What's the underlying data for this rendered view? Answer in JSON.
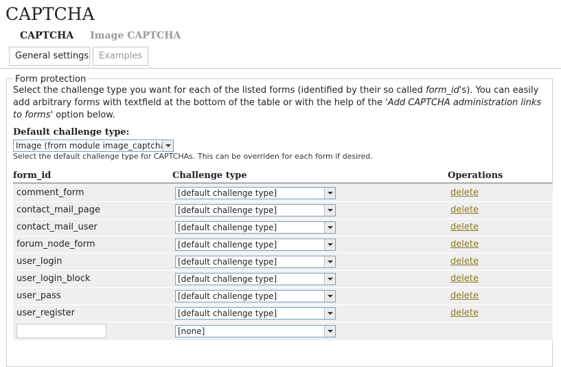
{
  "page": {
    "title": "CAPTCHA"
  },
  "primary_tabs": [
    {
      "label": "CAPTCHA",
      "active": true
    },
    {
      "label": "Image CAPTCHA",
      "active": false
    }
  ],
  "secondary_tabs": [
    {
      "label": "General settings",
      "active": true
    },
    {
      "label": "Examples",
      "active": false
    }
  ],
  "form_protection": {
    "legend": "Form protection",
    "description": {
      "part1": "Select the challenge type you want for each of the listed forms (identified by their so called ",
      "form_id_em": "form_id",
      "part2": "'s). You can easily add arbitrary forms with textfield at the bottom of the table or with the help of the '",
      "link_em": "Add CAPTCHA administration links to forms",
      "part3": "' option below."
    },
    "default_challenge": {
      "label": "Default challenge type:",
      "value": "Image (from module image_captcha)",
      "help": "Select the default challenge type for CAPTCHAs. This can be overriden for each form if desired."
    },
    "table": {
      "headers": {
        "form_id": "form_id",
        "challenge": "Challenge type",
        "operations": "Operations"
      },
      "rows": [
        {
          "form_id": "comment_form",
          "challenge": "[default challenge type]",
          "operation": "delete"
        },
        {
          "form_id": "contact_mail_page",
          "challenge": "[default challenge type]",
          "operation": "delete"
        },
        {
          "form_id": "contact_mail_user",
          "challenge": "[default challenge type]",
          "operation": "delete"
        },
        {
          "form_id": "forum_node_form",
          "challenge": "[default challenge type]",
          "operation": "delete"
        },
        {
          "form_id": "user_login",
          "challenge": "[default challenge type]",
          "operation": "delete"
        },
        {
          "form_id": "user_login_block",
          "challenge": "[default challenge type]",
          "operation": "delete"
        },
        {
          "form_id": "user_pass",
          "challenge": "[default challenge type]",
          "operation": "delete"
        },
        {
          "form_id": "user_register",
          "challenge": "[default challenge type]",
          "operation": "delete"
        }
      ],
      "new_row": {
        "form_id_value": "",
        "challenge": "[none]"
      }
    }
  },
  "colors": {
    "link": "#8a7a20",
    "row_bg": "#efefef",
    "inactive_tab": "#9a9a9a",
    "border": "#c8c8c8"
  },
  "icons": {
    "select_arrow": "chevron-down-icon"
  }
}
